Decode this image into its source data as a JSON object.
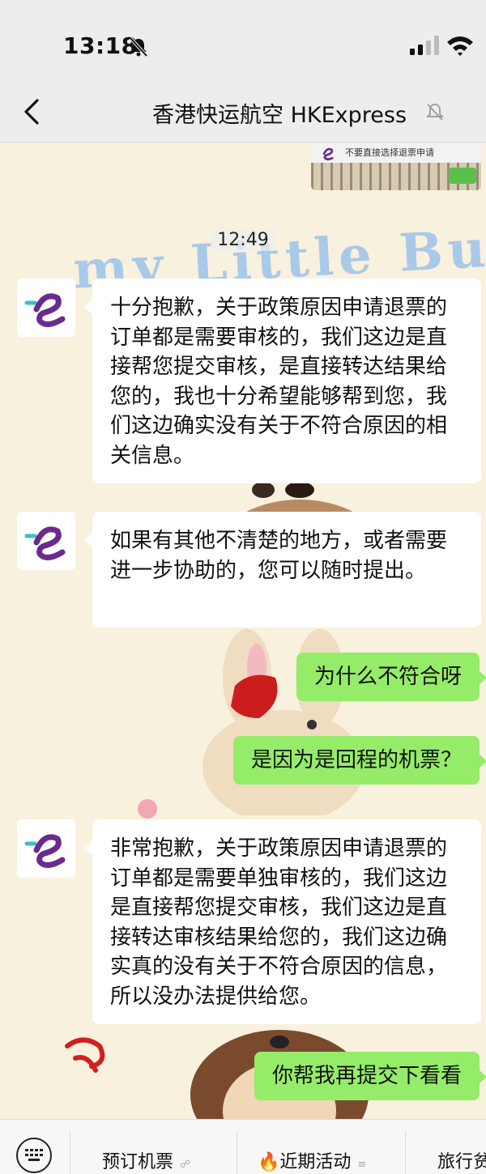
{
  "status_bar": {
    "time": "13:18"
  },
  "header": {
    "title": "香港快运航空 HKExpress"
  },
  "chat": {
    "banner_text": "不要直接选择退票申请",
    "decoration_text": "my Little Bud",
    "timestamp": "12:49",
    "messages": [
      {
        "sender": "HKExpress",
        "direction": "in",
        "text": "十分抱歉，关于政策原因申请退票的订单都是需要审核的，我们这边是直接帮您提交审核，是直接转达结果给您的，我也十分希望能够帮到您，我们这边确实没有关于不符合原因的相关信息。"
      },
      {
        "sender": "HKExpress",
        "direction": "in",
        "text": "如果有其他不清楚的地方，或者需要进一步协助的，您可以随时提出。"
      },
      {
        "sender": "me",
        "direction": "out",
        "text": "为什么不符合呀"
      },
      {
        "sender": "me",
        "direction": "out",
        "text": "是因为是回程的机票？"
      },
      {
        "sender": "HKExpress",
        "direction": "in",
        "text": "非常抱歉，关于政策原因申请退票的订单都是需要单独审核的，我们这边是直接帮您提交审核，我们这边是直接转达审核结果给您的，我们这边确实真的没有关于不符合原因的信息，所以没办法提供给您。"
      },
      {
        "sender": "me",
        "direction": "out",
        "text": "你帮我再提交下看看"
      }
    ]
  },
  "bottom_menu": {
    "items": [
      {
        "label": "预订机票",
        "icon": "link-icon"
      },
      {
        "label": "🔥近期活动",
        "icon": "menu-lines-icon"
      },
      {
        "label": "旅行贫"
      }
    ]
  },
  "colors": {
    "outgoing_bubble": "#95ec69",
    "incoming_bubble": "#ffffff",
    "brand_purple": "#6a2a8e",
    "brand_teal": "#3bbfc4"
  }
}
